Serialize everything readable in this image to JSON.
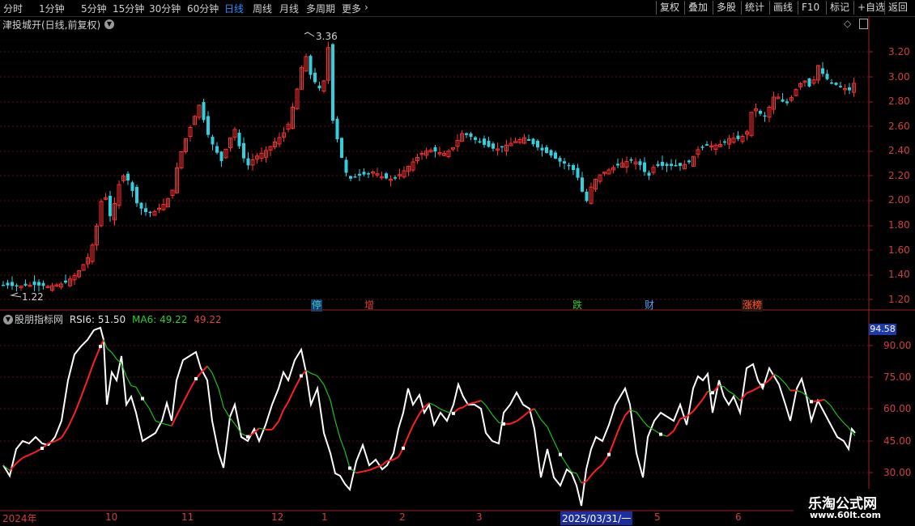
{
  "toolbar": {
    "periods": [
      "分时",
      "1分钟",
      "5分钟",
      "15分钟",
      "30分钟",
      "60分钟",
      "日线",
      "周线",
      "月线",
      "多周期",
      "更多"
    ],
    "active_period": "日线",
    "right_buttons": [
      "复权",
      "叠加",
      "多股",
      "统计",
      "画线",
      "F10",
      "标记",
      "+自选",
      "返回"
    ]
  },
  "chart_header": {
    "title": "津投城开(日线,前复权)"
  },
  "price_axis": [
    "3.20",
    "3.00",
    "2.80",
    "2.60",
    "2.40",
    "2.20",
    "2.00",
    "1.80",
    "1.60",
    "1.40",
    "1.20"
  ],
  "price_markers": {
    "high": "3.36",
    "low": "1.22"
  },
  "event_tags": [
    {
      "label": "停",
      "color": "#2fd0d0",
      "bg": "#1e3b6b"
    },
    {
      "label": "增",
      "color": "#e04040",
      "bg": "#000000"
    },
    {
      "label": "跌",
      "color": "#30d030",
      "bg": "#000000"
    },
    {
      "label": "财",
      "color": "#4aa8ff",
      "bg": "#000000"
    },
    {
      "label": "涨榜",
      "color": "#ff5030",
      "bg": "#000000"
    }
  ],
  "indicator": {
    "name": "股朋指标网",
    "rsi_label": "RSI6: 51.50",
    "ma_label": "MA6: 49.22",
    "value_label": "49.22",
    "axis": [
      "90.00",
      "75.00",
      "60.00",
      "45.00",
      "30.00"
    ],
    "current": "94.58",
    "rsi_color": "#ffffff",
    "ma_up_color": "#ff2020",
    "ma_down_color": "#20c020"
  },
  "dates": [
    "2024年",
    "10",
    "11",
    "12",
    "1",
    "2",
    "3",
    "2025/03/31/一",
    "5",
    "6"
  ],
  "watermark": {
    "line1": "乐淘公式网",
    "line2": "www.60lt.com"
  }
}
